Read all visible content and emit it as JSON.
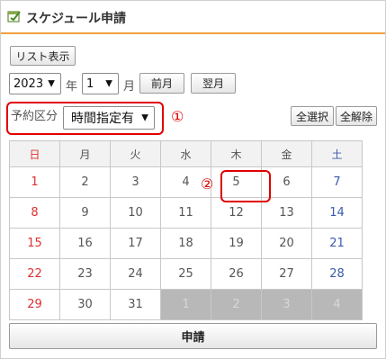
{
  "header": {
    "title": "スケジュール申請",
    "icon": "calendar-check-icon"
  },
  "toolbar": {
    "list_view_label": "リスト表示",
    "year_value": "2023",
    "year_label": "年",
    "month_value": "1",
    "month_label": "月",
    "prev_month_label": "前月",
    "next_month_label": "翌月"
  },
  "booking": {
    "label": "予約区分",
    "value": "時間指定有",
    "select_all_label": "全選択",
    "deselect_all_label": "全解除"
  },
  "annotations": {
    "marker_1": "①",
    "marker_2": "②",
    "color": "#e00000"
  },
  "calendar": {
    "weekdays": [
      "日",
      "月",
      "火",
      "水",
      "木",
      "金",
      "土"
    ],
    "weeks": [
      [
        "1",
        "2",
        "3",
        "4",
        "5",
        "6",
        "7"
      ],
      [
        "8",
        "9",
        "10",
        "11",
        "12",
        "13",
        "14"
      ],
      [
        "15",
        "16",
        "17",
        "18",
        "19",
        "20",
        "21"
      ],
      [
        "22",
        "23",
        "24",
        "25",
        "26",
        "27",
        "28"
      ],
      [
        "29",
        "30",
        "31",
        "1",
        "2",
        "3",
        "4"
      ]
    ]
  },
  "footer": {
    "submit_label": "申請"
  },
  "colors": {
    "accent": "#f0a040",
    "sunday": "#e03030",
    "saturday": "#3a5ab0",
    "disabled_cell": "#b8b8b8"
  }
}
